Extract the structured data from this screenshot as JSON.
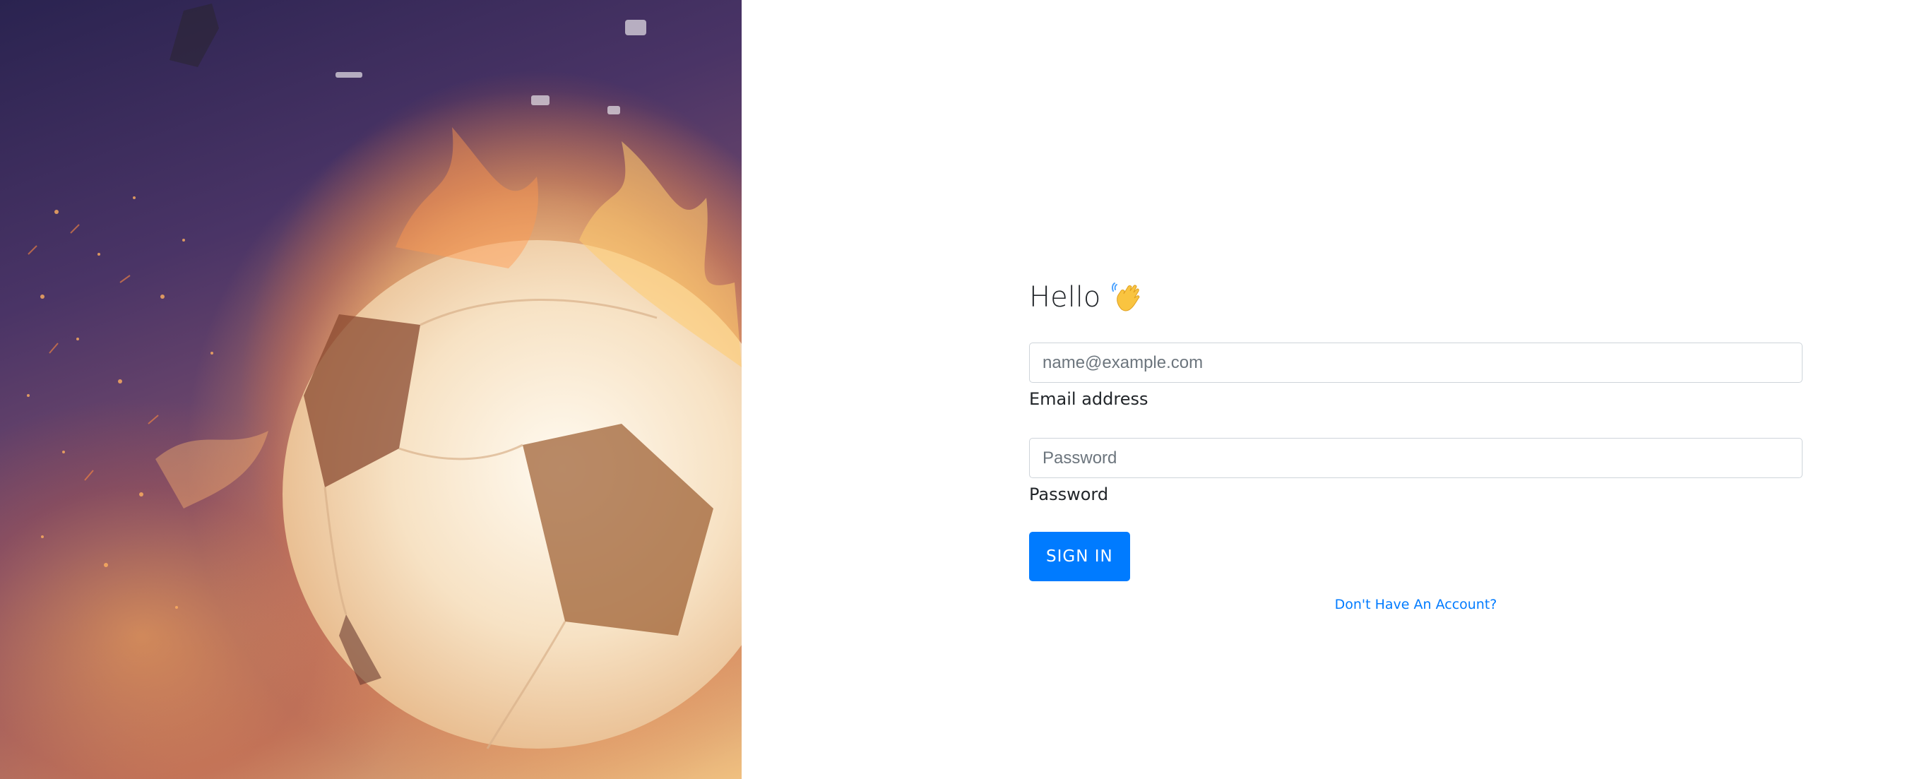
{
  "hero": {
    "image": "soccer-ball-on-fire"
  },
  "login": {
    "greeting": "Hello",
    "greeting_icon": "waving-hand-icon",
    "email": {
      "placeholder": "name@example.com",
      "value": "",
      "label": "Email address"
    },
    "password": {
      "placeholder": "Password",
      "value": "",
      "label": "Password"
    },
    "submit_label": "SIGN IN",
    "signup_link": "Don't Have An Account?"
  },
  "colors": {
    "accent": "#007bff",
    "text": "#212529",
    "border": "#ced4da"
  }
}
